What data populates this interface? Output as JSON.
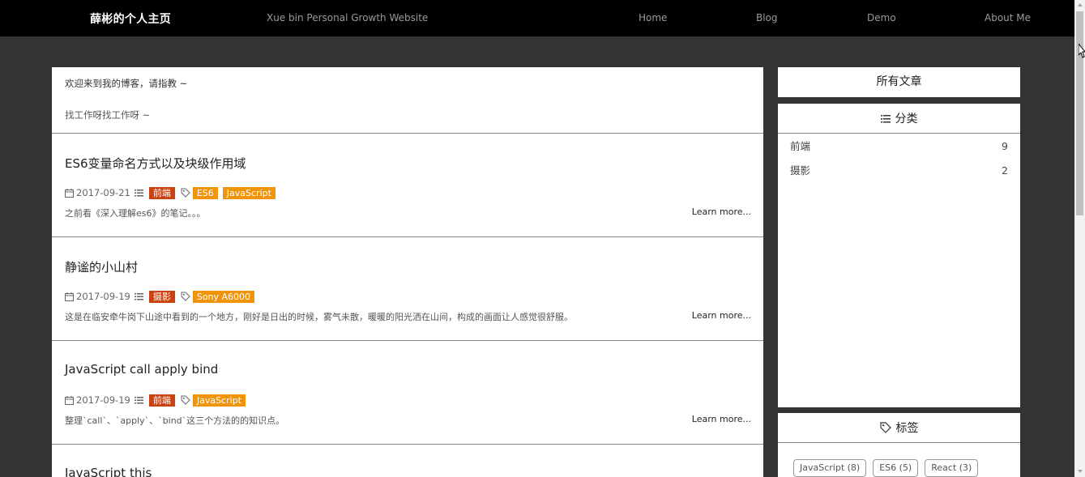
{
  "nav": {
    "brand": "薛彬的个人主页",
    "tagline": "Xue bin Personal Growth Website",
    "links": [
      "Home",
      "Blog",
      "Demo",
      "About Me"
    ]
  },
  "welcome": {
    "line1": "欢迎来到我的博客，请指教 ~",
    "line2": "找工作呀找工作呀 ~"
  },
  "posts": [
    {
      "title": "ES6变量命名方式以及块级作用域",
      "date": "2017-09-21",
      "category": "前端",
      "tags": [
        "ES6",
        "JavaScript"
      ],
      "excerpt": "之前看《深入理解es6》的笔记。。。",
      "more": "Learn more..."
    },
    {
      "title": "静谧的小山村",
      "date": "2017-09-19",
      "category": "摄影",
      "tags": [
        "Sony A6000"
      ],
      "excerpt": "这是在临安牵牛岗下山途中看到的一个地方，刚好是日出的时候，雾气未散，暖暖的阳光洒在山间，构成的画面让人感觉很舒服。",
      "more": "Learn more..."
    },
    {
      "title": "JavaScript call apply bind",
      "date": "2017-09-19",
      "category": "前端",
      "tags": [
        "JavaScript"
      ],
      "excerpt": "整理`call`、`apply`、`bind`这三个方法的的知识点。",
      "more": "Learn more..."
    },
    {
      "title": "JavaScript this"
    }
  ],
  "sidebar": {
    "all_articles": "所有文章",
    "categories_title": "分类",
    "categories": [
      {
        "name": "前端",
        "count": "9"
      },
      {
        "name": "摄影",
        "count": "2"
      }
    ],
    "tags_title": "标签",
    "tags": [
      "JavaScript (8)",
      "ES6 (5)",
      "React (3)"
    ]
  },
  "colors": {
    "category_badge": "#c9420f",
    "tag_badge": "#f0940c",
    "page_background": "#333333",
    "nav_background": "#000000"
  }
}
